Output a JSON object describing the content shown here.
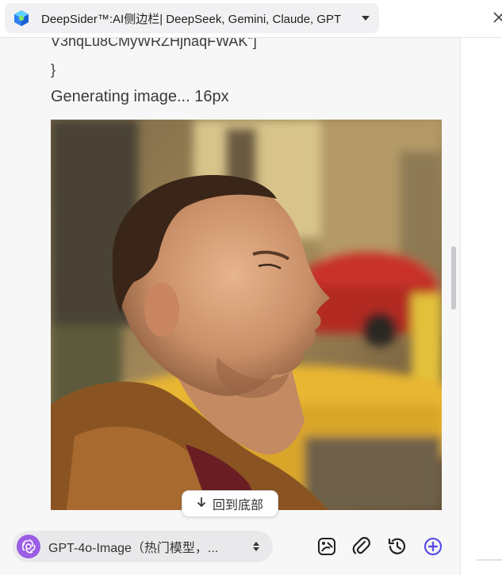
{
  "tab": {
    "title": "DeepSider™:AI侧边栏| DeepSeek, Gemini, Claude, GPT"
  },
  "chat": {
    "code_cut_line": "V3nqLu8CMyWRZHjnaqFWAK\"]",
    "code_brace": "}",
    "status": "Generating image... 16px"
  },
  "back_to_bottom": {
    "label": "回到底部"
  },
  "toolbar": {
    "model_name": "GPT-4o-Image（热门模型，..."
  },
  "icons": {
    "tab_logo": "deepsider-logo-icon",
    "dropdown": "caret-down-icon",
    "close": "close-icon",
    "back_arrow": "arrow-down-icon",
    "model": "openai-logo-icon",
    "model_switch": "sort-arrows-icon",
    "tool1": "image-edit-icon",
    "tool2": "paperclip-icon",
    "tool3": "history-icon",
    "tool4": "new-chat-icon"
  },
  "colors": {
    "accent": "#5b4ee6",
    "model_badge": "#9b5de5"
  }
}
